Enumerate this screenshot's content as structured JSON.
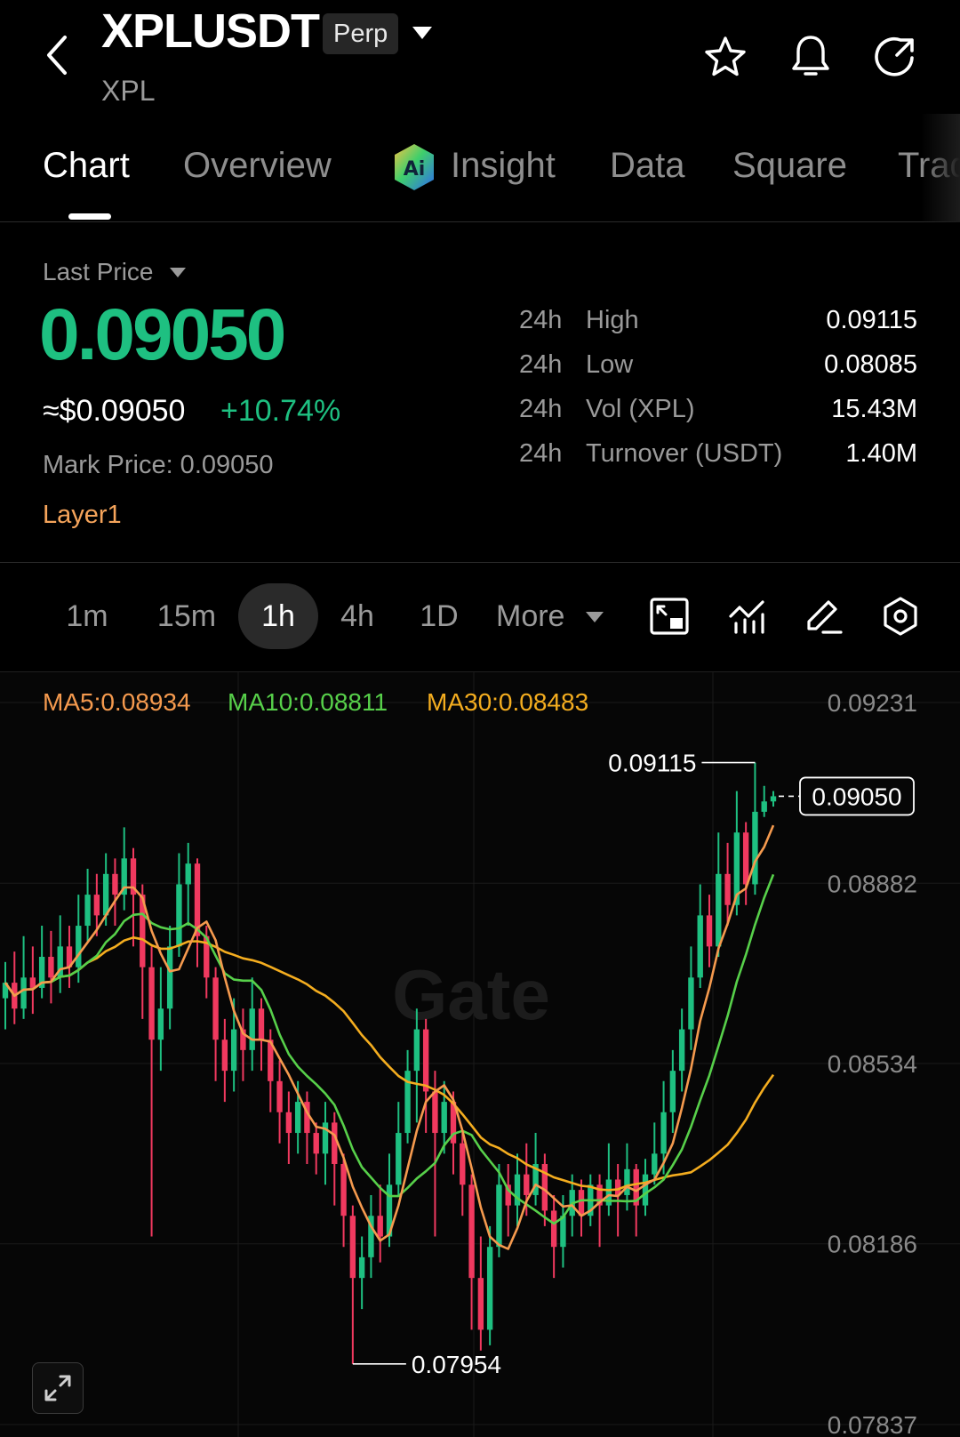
{
  "header": {
    "symbol": "XPLUSDT",
    "contract_type": "Perp",
    "base_asset": "XPL"
  },
  "tabs": [
    {
      "label": "Chart",
      "active": true
    },
    {
      "label": "Overview"
    },
    {
      "label": "Insight",
      "badge": "ai-icon"
    },
    {
      "label": "Data"
    },
    {
      "label": "Square"
    },
    {
      "label": "Trades"
    }
  ],
  "price": {
    "selector_label": "Last Price",
    "last": "0.09050",
    "approx_usd": "≈$0.09050",
    "change_pct": "+10.74%",
    "mark_price": "Mark Price: 0.09050",
    "sector_tag": "Layer1",
    "up_color": "#1ec081",
    "down_color": "#f0395f"
  },
  "stats": [
    {
      "period": "24h",
      "label": "High",
      "value": "0.09115"
    },
    {
      "period": "24h",
      "label": "Low",
      "value": "0.08085"
    },
    {
      "period": "24h",
      "label": "Vol (XPL)",
      "value": "15.43M"
    },
    {
      "period": "24h",
      "label": "Turnover (USDT)",
      "value": "1.40M"
    }
  ],
  "timeframes": [
    {
      "label": "1m"
    },
    {
      "label": "15m"
    },
    {
      "label": "1h",
      "active": true
    },
    {
      "label": "4h"
    },
    {
      "label": "1D"
    },
    {
      "label": "More"
    }
  ],
  "toolbar_icons": [
    "layout-icon",
    "indicator-icon",
    "draw-icon",
    "settings-icon"
  ],
  "indicators": {
    "ma5": "MA5:0.08934",
    "ma10": "MA10:0.08811",
    "ma30": "MA30:0.08483",
    "ma5_color": "#f59a4e",
    "ma10_color": "#57d04a",
    "ma30_color": "#f4ad1f"
  },
  "chart_data": {
    "type": "candlestick",
    "interval": "1h",
    "y_axis_ticks": [
      "0.09231",
      "0.08882",
      "0.08534",
      "0.08186",
      "0.07837"
    ],
    "ylim": [
      0.07837,
      0.09231
    ],
    "current_price_label": "0.09050",
    "current_price": 0.0905,
    "high_marker": {
      "label": "0.09115",
      "value": 0.09115
    },
    "low_marker": {
      "label": "0.07954",
      "value": 0.07954
    },
    "watermark": "Gate",
    "candles": [
      {
        "o": 0.0866,
        "c": 0.0869,
        "h": 0.0873,
        "l": 0.086
      },
      {
        "o": 0.0869,
        "c": 0.0864,
        "h": 0.0875,
        "l": 0.0861
      },
      {
        "o": 0.0864,
        "c": 0.087,
        "h": 0.0878,
        "l": 0.0862
      },
      {
        "o": 0.087,
        "c": 0.0868,
        "h": 0.0876,
        "l": 0.0863
      },
      {
        "o": 0.0868,
        "c": 0.0874,
        "h": 0.088,
        "l": 0.0866
      },
      {
        "o": 0.0874,
        "c": 0.087,
        "h": 0.0879,
        "l": 0.0865
      },
      {
        "o": 0.087,
        "c": 0.0876,
        "h": 0.0882,
        "l": 0.0867
      },
      {
        "o": 0.0876,
        "c": 0.0872,
        "h": 0.088,
        "l": 0.0868
      },
      {
        "o": 0.0872,
        "c": 0.088,
        "h": 0.0886,
        "l": 0.0869
      },
      {
        "o": 0.088,
        "c": 0.0886,
        "h": 0.0891,
        "l": 0.0877
      },
      {
        "o": 0.0886,
        "c": 0.0882,
        "h": 0.089,
        "l": 0.0878
      },
      {
        "o": 0.0882,
        "c": 0.089,
        "h": 0.0894,
        "l": 0.088
      },
      {
        "o": 0.089,
        "c": 0.0886,
        "h": 0.0893,
        "l": 0.088
      },
      {
        "o": 0.0886,
        "c": 0.0893,
        "h": 0.0899,
        "l": 0.0883
      },
      {
        "o": 0.0893,
        "c": 0.0886,
        "h": 0.0895,
        "l": 0.0876
      },
      {
        "o": 0.0886,
        "c": 0.0872,
        "h": 0.0888,
        "l": 0.0862
      },
      {
        "o": 0.0872,
        "c": 0.0858,
        "h": 0.0876,
        "l": 0.082
      },
      {
        "o": 0.0858,
        "c": 0.0864,
        "h": 0.0872,
        "l": 0.0852
      },
      {
        "o": 0.0864,
        "c": 0.0876,
        "h": 0.088,
        "l": 0.086
      },
      {
        "o": 0.0876,
        "c": 0.0888,
        "h": 0.0894,
        "l": 0.0874
      },
      {
        "o": 0.0888,
        "c": 0.0892,
        "h": 0.0896,
        "l": 0.088
      },
      {
        "o": 0.0892,
        "c": 0.0878,
        "h": 0.0893,
        "l": 0.0872
      },
      {
        "o": 0.0878,
        "c": 0.087,
        "h": 0.088,
        "l": 0.0866
      },
      {
        "o": 0.087,
        "c": 0.0858,
        "h": 0.0872,
        "l": 0.085
      },
      {
        "o": 0.0858,
        "c": 0.0852,
        "h": 0.0862,
        "l": 0.0846
      },
      {
        "o": 0.0852,
        "c": 0.086,
        "h": 0.0866,
        "l": 0.0848
      },
      {
        "o": 0.086,
        "c": 0.0856,
        "h": 0.0864,
        "l": 0.085
      },
      {
        "o": 0.0856,
        "c": 0.0864,
        "h": 0.087,
        "l": 0.0852
      },
      {
        "o": 0.0864,
        "c": 0.0858,
        "h": 0.0866,
        "l": 0.0852
      },
      {
        "o": 0.0858,
        "c": 0.085,
        "h": 0.086,
        "l": 0.0844
      },
      {
        "o": 0.085,
        "c": 0.0844,
        "h": 0.0854,
        "l": 0.0838
      },
      {
        "o": 0.0844,
        "c": 0.084,
        "h": 0.0848,
        "l": 0.0834
      },
      {
        "o": 0.084,
        "c": 0.0846,
        "h": 0.085,
        "l": 0.0836
      },
      {
        "o": 0.0846,
        "c": 0.084,
        "h": 0.0848,
        "l": 0.0834
      },
      {
        "o": 0.084,
        "c": 0.0836,
        "h": 0.0842,
        "l": 0.0832
      },
      {
        "o": 0.0836,
        "c": 0.0842,
        "h": 0.0846,
        "l": 0.083
      },
      {
        "o": 0.0842,
        "c": 0.0834,
        "h": 0.0844,
        "l": 0.0826
      },
      {
        "o": 0.0834,
        "c": 0.0824,
        "h": 0.0836,
        "l": 0.0818
      },
      {
        "o": 0.0824,
        "c": 0.0812,
        "h": 0.0826,
        "l": 0.07954
      },
      {
        "o": 0.0812,
        "c": 0.0816,
        "h": 0.082,
        "l": 0.0806
      },
      {
        "o": 0.0816,
        "c": 0.0824,
        "h": 0.0828,
        "l": 0.0812
      },
      {
        "o": 0.0824,
        "c": 0.082,
        "h": 0.083,
        "l": 0.0815
      },
      {
        "o": 0.082,
        "c": 0.083,
        "h": 0.0836,
        "l": 0.0818
      },
      {
        "o": 0.083,
        "c": 0.084,
        "h": 0.0846,
        "l": 0.0828
      },
      {
        "o": 0.084,
        "c": 0.0852,
        "h": 0.0856,
        "l": 0.0838
      },
      {
        "o": 0.0852,
        "c": 0.086,
        "h": 0.0864,
        "l": 0.0842
      },
      {
        "o": 0.086,
        "c": 0.0848,
        "h": 0.0862,
        "l": 0.084
      },
      {
        "o": 0.0848,
        "c": 0.084,
        "h": 0.0852,
        "l": 0.082
      },
      {
        "o": 0.084,
        "c": 0.0846,
        "h": 0.085,
        "l": 0.0836
      },
      {
        "o": 0.0846,
        "c": 0.0838,
        "h": 0.0848,
        "l": 0.0832
      },
      {
        "o": 0.0838,
        "c": 0.083,
        "h": 0.084,
        "l": 0.0824
      },
      {
        "o": 0.083,
        "c": 0.0812,
        "h": 0.0832,
        "l": 0.0802
      },
      {
        "o": 0.0812,
        "c": 0.0802,
        "h": 0.082,
        "l": 0.0798
      },
      {
        "o": 0.0802,
        "c": 0.0818,
        "h": 0.0822,
        "l": 0.0799
      },
      {
        "o": 0.0818,
        "c": 0.083,
        "h": 0.0834,
        "l": 0.0816
      },
      {
        "o": 0.083,
        "c": 0.0826,
        "h": 0.0834,
        "l": 0.082
      },
      {
        "o": 0.0826,
        "c": 0.0832,
        "h": 0.0836,
        "l": 0.0822
      },
      {
        "o": 0.0832,
        "c": 0.0828,
        "h": 0.0838,
        "l": 0.0824
      },
      {
        "o": 0.0828,
        "c": 0.0834,
        "h": 0.084,
        "l": 0.0826
      },
      {
        "o": 0.0834,
        "c": 0.0825,
        "h": 0.0836,
        "l": 0.0822
      },
      {
        "o": 0.0825,
        "c": 0.0818,
        "h": 0.0828,
        "l": 0.0812
      },
      {
        "o": 0.0818,
        "c": 0.0824,
        "h": 0.0828,
        "l": 0.0814
      },
      {
        "o": 0.0824,
        "c": 0.0829,
        "h": 0.0832,
        "l": 0.082
      },
      {
        "o": 0.0829,
        "c": 0.0824,
        "h": 0.0831,
        "l": 0.082
      },
      {
        "o": 0.0824,
        "c": 0.083,
        "h": 0.0832,
        "l": 0.0822
      },
      {
        "o": 0.083,
        "c": 0.0826,
        "h": 0.0832,
        "l": 0.0818
      },
      {
        "o": 0.0826,
        "c": 0.0831,
        "h": 0.0838,
        "l": 0.0824
      },
      {
        "o": 0.0831,
        "c": 0.0828,
        "h": 0.0834,
        "l": 0.082
      },
      {
        "o": 0.0828,
        "c": 0.0833,
        "h": 0.0838,
        "l": 0.0825
      },
      {
        "o": 0.0833,
        "c": 0.0826,
        "h": 0.0834,
        "l": 0.082
      },
      {
        "o": 0.0826,
        "c": 0.0832,
        "h": 0.0835,
        "l": 0.0824
      },
      {
        "o": 0.0832,
        "c": 0.0836,
        "h": 0.0842,
        "l": 0.083
      },
      {
        "o": 0.0836,
        "c": 0.0844,
        "h": 0.085,
        "l": 0.0832
      },
      {
        "o": 0.0844,
        "c": 0.0852,
        "h": 0.0856,
        "l": 0.084
      },
      {
        "o": 0.0852,
        "c": 0.086,
        "h": 0.0864,
        "l": 0.0848
      },
      {
        "o": 0.086,
        "c": 0.087,
        "h": 0.0876,
        "l": 0.0856
      },
      {
        "o": 0.087,
        "c": 0.0882,
        "h": 0.0888,
        "l": 0.0868
      },
      {
        "o": 0.0882,
        "c": 0.0876,
        "h": 0.0886,
        "l": 0.0872
      },
      {
        "o": 0.0876,
        "c": 0.089,
        "h": 0.0898,
        "l": 0.0874
      },
      {
        "o": 0.089,
        "c": 0.0884,
        "h": 0.0896,
        "l": 0.088
      },
      {
        "o": 0.0884,
        "c": 0.0898,
        "h": 0.0906,
        "l": 0.0882
      },
      {
        "o": 0.0898,
        "c": 0.0888,
        "h": 0.09,
        "l": 0.0884
      },
      {
        "o": 0.0888,
        "c": 0.0902,
        "h": 0.09115,
        "l": 0.0886
      },
      {
        "o": 0.0902,
        "c": 0.0904,
        "h": 0.0907,
        "l": 0.0901
      },
      {
        "o": 0.0904,
        "c": 0.0905,
        "h": 0.0906,
        "l": 0.0903
      }
    ]
  }
}
